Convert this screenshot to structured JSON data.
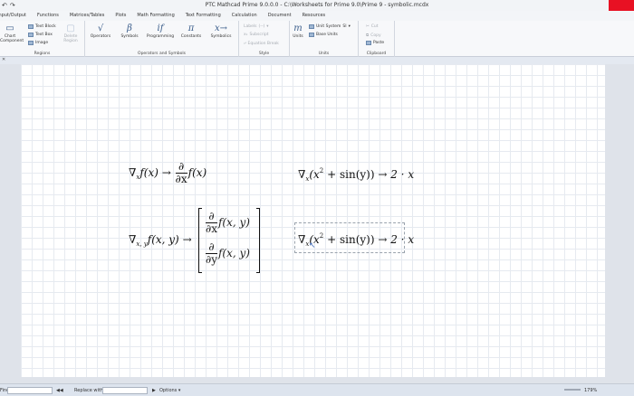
{
  "window": {
    "title": "PTC Mathcad Prime 9.0.0.0 - C:\\Worksheets for Prime 9.0\\Prime 9 - symbolic.mcdx",
    "quick_access": [
      "↶",
      "↷"
    ]
  },
  "ribbon_tabs": [
    "Input/Output",
    "Functions",
    "Matrices/Tables",
    "Plots",
    "Math Formatting",
    "Text Formatting",
    "Calculation",
    "Document",
    "Resources"
  ],
  "ribbon": {
    "regions": {
      "title": "Regions",
      "chart_component": "Chart Component",
      "text_block": "Text Block",
      "text_box": "Text Box",
      "image": "Image",
      "delete_region": "Delete Region"
    },
    "operators_symbols": {
      "title": "Operators and Symbols",
      "operators": "Operators",
      "symbols": "Symbols",
      "programming": "Programming",
      "constants": "Constants",
      "symbolics": "Symbolics",
      "glyph_operators": "√",
      "glyph_symbols": "β",
      "glyph_programming": "if",
      "glyph_constants": "π",
      "glyph_symbolics": "x→"
    },
    "style": {
      "title": "Style",
      "labels": "Labels",
      "labels_value": "(--)",
      "subscript": "Subscript",
      "equation_break": "Equation Break"
    },
    "units": {
      "title": "Units",
      "units": "Units",
      "glyph_units": "m",
      "unit_system": "Unit System",
      "unit_system_value": "SI",
      "base_units": "Base Units"
    },
    "clipboard": {
      "title": "Clipboard",
      "cut": "Cut",
      "copy": "Copy",
      "paste": "Paste"
    }
  },
  "document_tab": "✕",
  "worksheet": {
    "eq1_lhs_op": "∇",
    "eq1_lhs_sub": "x",
    "eq1_lhs_func": "f(x)",
    "eq1_arrow": "→",
    "eq1_num": "∂",
    "eq1_den": "∂x",
    "eq1_rhs_func": "f(x)",
    "eq2_op": "∇",
    "eq2_sub": "x",
    "eq2_body_a": "(x",
    "eq2_sup": "2",
    "eq2_body_b": "+ sin(y))",
    "eq2_arrow": "→",
    "eq2_result": "2 · x",
    "eq3_op": "∇",
    "eq3_sub": "x, y",
    "eq3_func": "f(x, y)",
    "eq3_arrow": "→",
    "eq3_row1_num": "∂",
    "eq3_row1_den": "∂x",
    "eq3_row1_func": "f(x, y)",
    "eq3_row2_num": "∂",
    "eq3_row2_den": "∂y",
    "eq3_row2_func": "f(x, y)",
    "eq4_op": "∇",
    "eq4_sub": "x",
    "eq4_body_a": "(x",
    "eq4_sup": "2",
    "eq4_body_b": "+ sin(y))",
    "eq4_arrow": "→",
    "eq4_result": "2 · x"
  },
  "statusbar": {
    "find_label": "Find:",
    "replace_label": "Replace with:",
    "options_label": "Options",
    "zoom": "179%"
  }
}
